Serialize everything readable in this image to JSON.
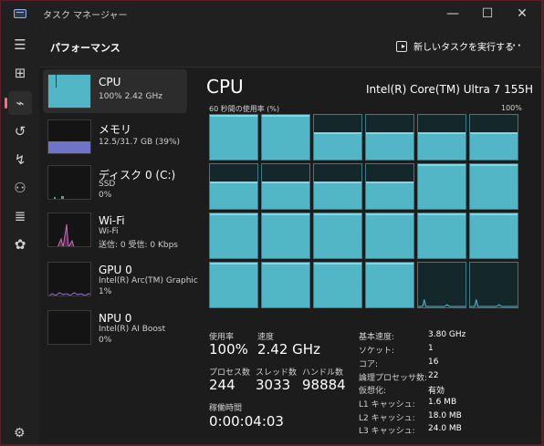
{
  "app": {
    "title": "タスク マネージャー"
  },
  "window": {
    "minimize_glyph": "—",
    "maximize_glyph": "☐",
    "close_glyph": "✕"
  },
  "sidebar": {
    "items": [
      {
        "name": "hamburger-icon",
        "glyph": "☰"
      },
      {
        "name": "processes-icon",
        "glyph": "⊞"
      },
      {
        "name": "performance-icon",
        "glyph": "⌁"
      },
      {
        "name": "app-history-icon",
        "glyph": "↺"
      },
      {
        "name": "startup-apps-icon",
        "glyph": "↯"
      },
      {
        "name": "users-icon",
        "glyph": "⚇"
      },
      {
        "name": "details-icon",
        "glyph": "≣"
      },
      {
        "name": "services-icon",
        "glyph": "✿"
      }
    ],
    "settings_glyph": "⚙"
  },
  "header": {
    "title": "パフォーマンス",
    "run_task_label": "新しいタスクを実行する",
    "more_glyph": "···"
  },
  "perf_list": [
    {
      "key": "cpu",
      "title": "CPU",
      "sub": "100%  2.42 GHz",
      "color": "#52b6c7"
    },
    {
      "key": "memory",
      "title": "メモリ",
      "sub": "12.5/31.7 GB (39%)",
      "color": "#7b7fd4"
    },
    {
      "key": "disk",
      "title": "ディスク 0 (C:)",
      "sub1": "SSD",
      "sub2": "0%",
      "color": "#4caf7a"
    },
    {
      "key": "wifi",
      "title": "Wi-Fi",
      "sub1": "Wi-Fi",
      "sub2": "送信: 0  受信: 0 Kbps",
      "color": "#c46fb3"
    },
    {
      "key": "gpu",
      "title": "GPU 0",
      "sub1": "Intel(R) Arc(TM) Graphic",
      "sub2": "1%",
      "color": "#9a6fd4"
    },
    {
      "key": "npu",
      "title": "NPU 0",
      "sub1": "Intel(R) AI Boost",
      "sub2": "0%",
      "color": "#7fb6d4"
    }
  ],
  "main": {
    "title": "CPU",
    "model": "Intel(R) Core(TM) Ultra 7 155H",
    "graph_label": "60 秒間の使用率 (%)",
    "graph_max": "100%",
    "accent": "#52b6c7",
    "core_usage_percent": [
      100,
      100,
      62,
      62,
      62,
      62,
      62,
      62,
      62,
      62,
      100,
      100,
      100,
      100,
      100,
      100,
      100,
      100,
      100,
      100,
      100,
      100,
      5,
      5
    ]
  },
  "stats": {
    "utilization_label": "使用率",
    "utilization_value": "100%",
    "speed_label": "速度",
    "speed_value": "2.42 GHz",
    "processes_label": "プロセス数",
    "processes_value": "244",
    "threads_label": "スレッド数",
    "threads_value": "3033",
    "handles_label": "ハンドル数",
    "handles_value": "98884",
    "uptime_label": "稼働時間",
    "uptime_value": "0:00:04:03"
  },
  "specs": [
    {
      "label": "基本速度:",
      "value": "3.80 GHz"
    },
    {
      "label": "ソケット:",
      "value": "1"
    },
    {
      "label": "コア:",
      "value": "16"
    },
    {
      "label": "論理プロセッサ数:",
      "value": "22"
    },
    {
      "label": "仮想化:",
      "value": "有効"
    },
    {
      "label": "L1 キャッシュ:",
      "value": "1.6 MB"
    },
    {
      "label": "L2 キャッシュ:",
      "value": "18.0 MB"
    },
    {
      "label": "L3 キャッシュ:",
      "value": "24.0 MB"
    }
  ]
}
